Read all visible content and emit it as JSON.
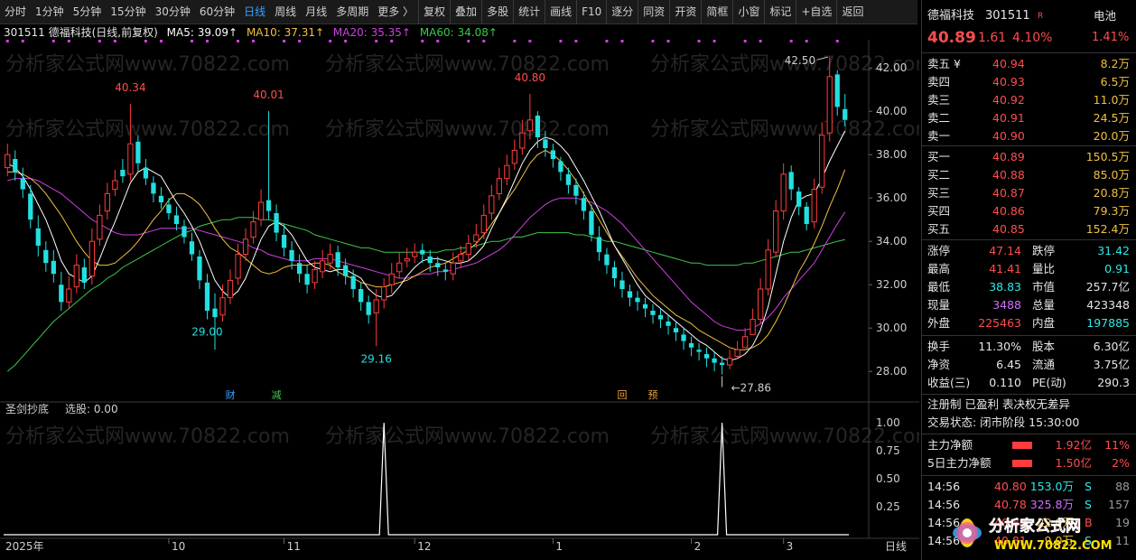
{
  "toolbar": {
    "periods": [
      "分时",
      "1分钟",
      "5分钟",
      "15分钟",
      "30分钟",
      "60分钟",
      "日线",
      "周线",
      "月线",
      "多周期",
      "更多 〉"
    ],
    "active": "日线",
    "tools": [
      "复权",
      "叠加",
      "多股",
      "统计",
      "画线",
      "F10",
      "逐分",
      "同资",
      "开资",
      "简框",
      "小窗",
      "标记",
      "+自选",
      "返回"
    ]
  },
  "header": {
    "stock": "301511 德福科技(日线,前复权)",
    "ma5": "MA5: 39.09↑",
    "ma10": "MA10: 37.31↑",
    "ma20": "MA20: 35.35↑",
    "ma60": "MA60: 34.08↑"
  },
  "sub_header": {
    "name": "圣剑抄底",
    "value": "选股: 0.00"
  },
  "watermark": "分析家公式网www.70822.com",
  "colors": {
    "up": "#ff3c3c",
    "down": "#22e0e0",
    "ma5": "#ffffff",
    "ma10": "#f0c040",
    "ma20": "#d040e0",
    "ma60": "#3cc84a"
  },
  "chart_data": {
    "type": "candlestick",
    "ylim": [
      27.3,
      43.3
    ],
    "y_ticks": [
      "42.00",
      "40.00",
      "38.00",
      "36.00",
      "34.00",
      "32.00",
      "30.00",
      "28.00"
    ],
    "y_tick_values": [
      42,
      40,
      38,
      36,
      34,
      32,
      30,
      28
    ],
    "x_ticks": [
      "2025年",
      "10",
      "11",
      "12",
      "1",
      "2",
      "3"
    ],
    "x_tick_idx": [
      0,
      21,
      36,
      53,
      71,
      89,
      101
    ],
    "annotations_high": [
      {
        "i": 16,
        "label": "40.34"
      },
      {
        "i": 34,
        "label": "40.01"
      },
      {
        "i": 68,
        "label": "40.80"
      },
      {
        "i": 107,
        "label": "42.50"
      }
    ],
    "annotations_low": [
      {
        "i": 26,
        "label": "29.00"
      },
      {
        "i": 48,
        "label": "29.16"
      },
      {
        "i": 93,
        "label": "27.86"
      }
    ],
    "events": [
      {
        "i": 29,
        "label": "财"
      },
      {
        "i": 35,
        "label": "减"
      },
      {
        "i": 80,
        "label": "回"
      },
      {
        "i": 84,
        "label": "预"
      }
    ],
    "closes": [
      38.0,
      37.2,
      36.4,
      35.0,
      33.8,
      33.0,
      32.5,
      31.2,
      31.8,
      32.9,
      32.1,
      34.0,
      35.2,
      36.2,
      36.8,
      37.0,
      38.5,
      37.6,
      36.9,
      36.2,
      35.8,
      35.3,
      34.8,
      34.2,
      33.4,
      32.2,
      30.8,
      30.5,
      31.4,
      32.2,
      33.4,
      34.1,
      34.9,
      35.8,
      35.4,
      34.4,
      33.7,
      33.1,
      32.5,
      32.0,
      32.7,
      33.1,
      33.4,
      32.8,
      32.4,
      31.8,
      31.2,
      30.6,
      31.3,
      31.9,
      32.5,
      33.0,
      33.2,
      33.5,
      33.4,
      33.0,
      32.8,
      32.6,
      33.0,
      33.4,
      33.9,
      34.3,
      35.2,
      36.1,
      36.9,
      37.5,
      38.2,
      39.0,
      39.6,
      38.8,
      38.3,
      37.8,
      37.2,
      36.6,
      36.1,
      35.4,
      34.3,
      33.5,
      32.9,
      32.3,
      31.8,
      31.4,
      31.2,
      30.9,
      30.6,
      30.4,
      30.1,
      29.8,
      29.4,
      29.1,
      28.9,
      28.6,
      28.4,
      28.3,
      28.6,
      29.0,
      29.6,
      30.4,
      31.8,
      33.6,
      35.4,
      37.1,
      36.4,
      35.6,
      34.8,
      36.4,
      38.9,
      41.6,
      40.2,
      39.6
    ],
    "opens": [
      37.4,
      37.8,
      36.9,
      36.2,
      34.6,
      33.6,
      33.1,
      32.0,
      31.2,
      31.9,
      32.8,
      32.4,
      34.1,
      35.4,
      36.4,
      37.3,
      37.1,
      38.6,
      37.4,
      36.7,
      36.1,
      35.7,
      35.2,
      34.7,
      34.0,
      33.3,
      32.1,
      30.9,
      30.6,
      31.4,
      32.3,
      33.4,
      34.2,
      35.0,
      35.9,
      35.3,
      34.3,
      33.6,
      33.0,
      32.5,
      32.1,
      32.6,
      33.0,
      33.5,
      32.9,
      32.4,
      31.8,
      31.2,
      30.7,
      31.3,
      32.0,
      32.6,
      33.1,
      33.3,
      33.6,
      33.3,
      33.0,
      32.7,
      32.5,
      33.1,
      33.4,
      34.0,
      34.4,
      35.3,
      36.2,
      36.9,
      37.6,
      38.3,
      39.1,
      39.8,
      38.7,
      38.2,
      37.7,
      37.1,
      36.6,
      36.0,
      35.4,
      34.2,
      33.4,
      32.8,
      32.2,
      31.7,
      31.4,
      31.1,
      30.8,
      30.6,
      30.3,
      30.0,
      29.7,
      29.3,
      29.0,
      28.8,
      28.6,
      28.4,
      28.3,
      28.7,
      29.1,
      29.7,
      30.4,
      31.8,
      33.5,
      35.4,
      37.2,
      36.3,
      35.6,
      34.9,
      36.5,
      39.0,
      41.7,
      40.1
    ],
    "highs": [
      38.5,
      38.2,
      37.4,
      36.6,
      35.2,
      34.0,
      33.6,
      32.6,
      32.4,
      33.4,
      33.2,
      34.6,
      35.7,
      36.7,
      37.3,
      37.8,
      40.34,
      38.9,
      37.8,
      37.0,
      36.5,
      36.0,
      35.6,
      35.0,
      34.4,
      33.6,
      32.5,
      31.6,
      32.0,
      32.7,
      33.9,
      34.6,
      35.4,
      36.4,
      40.01,
      35.7,
      34.8,
      34.0,
      33.4,
      32.9,
      33.1,
      33.6,
      33.9,
      33.8,
      33.2,
      32.7,
      32.1,
      31.5,
      31.8,
      32.3,
      33.0,
      33.5,
      33.7,
      33.9,
      33.9,
      33.6,
      33.3,
      33.0,
      33.5,
      33.8,
      34.3,
      34.8,
      35.7,
      36.6,
      37.4,
      38.0,
      38.7,
      39.6,
      40.8,
      40.0,
      39.1,
      38.5,
      37.9,
      37.4,
      36.9,
      36.3,
      35.7,
      34.7,
      33.7,
      33.1,
      32.6,
      32.0,
      31.7,
      31.4,
      31.1,
      30.9,
      30.6,
      30.3,
      30.0,
      29.6,
      29.3,
      29.1,
      28.9,
      28.7,
      29.0,
      29.4,
      30.0,
      30.9,
      32.3,
      34.1,
      35.9,
      37.6,
      37.5,
      36.5,
      35.8,
      36.9,
      39.5,
      42.5,
      41.9,
      40.8
    ],
    "lows": [
      37.0,
      36.8,
      36.0,
      34.6,
      33.3,
      32.6,
      32.1,
      30.8,
      30.9,
      31.6,
      31.8,
      32.0,
      33.8,
      35.0,
      36.1,
      36.7,
      36.8,
      37.2,
      36.6,
      35.8,
      35.5,
      35.0,
      34.5,
      33.9,
      33.1,
      31.8,
      30.4,
      29.0,
      30.3,
      31.1,
      32.0,
      33.1,
      33.9,
      34.7,
      35.0,
      34.0,
      33.3,
      32.7,
      32.1,
      31.6,
      31.8,
      32.3,
      32.7,
      32.4,
      32.0,
      31.4,
      30.8,
      30.2,
      29.16,
      30.9,
      31.6,
      32.3,
      32.8,
      33.0,
      33.0,
      32.6,
      32.4,
      32.2,
      32.2,
      32.8,
      33.1,
      33.7,
      34.1,
      35.0,
      35.9,
      36.6,
      37.3,
      38.0,
      38.7,
      38.3,
      37.9,
      37.4,
      36.8,
      36.2,
      35.7,
      35.0,
      34.0,
      33.1,
      32.5,
      31.9,
      31.4,
      31.0,
      30.8,
      30.5,
      30.2,
      30.0,
      29.7,
      29.4,
      29.0,
      28.7,
      28.5,
      28.2,
      28.0,
      27.86,
      28.1,
      28.6,
      29.2,
      30.0,
      30.2,
      31.5,
      33.3,
      35.0,
      35.9,
      35.2,
      34.5,
      34.6,
      36.2,
      38.6,
      39.8,
      39.3
    ],
    "ma5": [
      37.6,
      37.4,
      37.0,
      36.4,
      35.7,
      35.0,
      34.1,
      33.1,
      32.5,
      32.3,
      32.1,
      32.4,
      33.2,
      34.1,
      34.9,
      35.8,
      36.7,
      37.2,
      37.4,
      37.2,
      37.0,
      36.4,
      35.8,
      35.3,
      34.7,
      34.0,
      33.1,
      32.2,
      31.7,
      31.4,
      31.7,
      32.3,
      33.2,
      34.1,
      34.7,
      34.9,
      34.7,
      34.3,
      33.7,
      33.1,
      32.8,
      32.7,
      32.6,
      32.7,
      32.7,
      32.5,
      32.3,
      31.8,
      31.5,
      31.4,
      31.5,
      31.9,
      32.4,
      32.8,
      33.1,
      33.2,
      33.2,
      33.1,
      33.0,
      33.0,
      33.1,
      33.4,
      33.8,
      34.6,
      35.3,
      36.0,
      36.8,
      37.6,
      38.2,
      38.6,
      38.8,
      38.7,
      38.4,
      38.0,
      37.4,
      36.8,
      36.1,
      35.4,
      34.6,
      33.8,
      33.2,
      32.6,
      32.0,
      31.5,
      31.2,
      30.9,
      30.6,
      30.3,
      30.0,
      29.7,
      29.4,
      29.2,
      28.9,
      28.6,
      28.5,
      28.6,
      28.8,
      29.2,
      29.9,
      31.0,
      32.5,
      34.0,
      35.1,
      35.9,
      36.1,
      36.2,
      36.9,
      37.7,
      38.4,
      39.09
    ],
    "ma10": [
      37.2,
      37.2,
      37.1,
      36.9,
      36.6,
      36.2,
      35.7,
      35.2,
      34.6,
      34.0,
      33.5,
      33.1,
      32.9,
      32.9,
      33.0,
      33.3,
      33.6,
      34.0,
      34.5,
      35.0,
      35.4,
      35.9,
      36.2,
      36.2,
      36.0,
      35.7,
      35.2,
      34.6,
      34.1,
      33.7,
      33.5,
      33.2,
      32.9,
      32.6,
      32.5,
      32.6,
      32.8,
      32.9,
      32.9,
      32.9,
      33.0,
      33.0,
      32.9,
      32.6,
      32.4,
      32.3,
      32.1,
      32.0,
      31.9,
      31.9,
      32.0,
      32.1,
      32.2,
      32.4,
      32.6,
      32.8,
      32.9,
      33.0,
      33.2,
      33.4,
      33.6,
      33.9,
      34.3,
      34.8,
      35.3,
      35.9,
      36.4,
      37.0,
      37.6,
      38.0,
      38.2,
      38.0,
      37.7,
      37.3,
      36.8,
      36.2,
      35.6,
      35.0,
      34.4,
      33.8,
      33.3,
      32.8,
      32.3,
      31.9,
      31.5,
      31.2,
      30.9,
      30.6,
      30.4,
      30.2,
      29.9,
      29.7,
      29.5,
      29.3,
      29.1,
      29.0,
      29.0,
      29.1,
      29.3,
      29.7,
      30.3,
      31.0,
      31.8,
      32.6,
      33.2,
      33.9,
      34.7,
      35.6,
      36.4,
      37.31
    ],
    "ma20": [
      36.8,
      36.9,
      36.9,
      36.9,
      36.8,
      36.6,
      36.4,
      36.2,
      35.9,
      35.6,
      35.3,
      35.0,
      34.8,
      34.6,
      34.4,
      34.3,
      34.3,
      34.3,
      34.4,
      34.5,
      34.6,
      34.6,
      34.6,
      34.6,
      34.6,
      34.5,
      34.4,
      34.3,
      34.2,
      34.1,
      34.0,
      33.9,
      33.7,
      33.6,
      33.4,
      33.3,
      33.2,
      33.1,
      33.1,
      33.1,
      33.2,
      33.2,
      33.2,
      33.1,
      33.0,
      32.9,
      32.8,
      32.7,
      32.6,
      32.5,
      32.4,
      32.3,
      32.3,
      32.4,
      32.5,
      32.5,
      32.6,
      32.6,
      32.7,
      32.8,
      32.9,
      33.0,
      33.2,
      33.4,
      33.6,
      33.9,
      34.3,
      34.7,
      35.1,
      35.4,
      35.7,
      35.9,
      36.0,
      36.0,
      36.0,
      35.9,
      35.8,
      35.6,
      35.4,
      35.1,
      34.8,
      34.4,
      34.0,
      33.6,
      33.2,
      32.8,
      32.4,
      32.0,
      31.6,
      31.2,
      30.9,
      30.6,
      30.3,
      30.1,
      30.0,
      29.9,
      29.9,
      30.0,
      30.2,
      30.5,
      30.9,
      31.4,
      31.8,
      32.2,
      32.6,
      33.0,
      33.6,
      34.2,
      34.8,
      35.35
    ],
    "ma60": [
      28.0,
      28.3,
      28.7,
      29.1,
      29.5,
      29.9,
      30.3,
      30.6,
      30.9,
      31.2,
      31.5,
      31.8,
      32.0,
      32.3,
      32.5,
      32.8,
      33.0,
      33.2,
      33.4,
      33.6,
      33.8,
      34.0,
      34.2,
      34.4,
      34.5,
      34.7,
      34.8,
      34.9,
      35.0,
      35.0,
      35.1,
      35.1,
      35.1,
      35.0,
      35.0,
      34.9,
      34.8,
      34.7,
      34.6,
      34.5,
      34.3,
      34.2,
      34.1,
      34.0,
      33.9,
      33.8,
      33.7,
      33.7,
      33.6,
      33.5,
      33.5,
      33.5,
      33.5,
      33.5,
      33.5,
      33.5,
      33.5,
      33.6,
      33.6,
      33.7,
      33.7,
      33.8,
      33.9,
      34.0,
      34.0,
      34.1,
      34.2,
      34.2,
      34.3,
      34.4,
      34.4,
      34.4,
      34.4,
      34.4,
      34.3,
      34.3,
      34.2,
      34.1,
      34.0,
      34.0,
      33.9,
      33.8,
      33.7,
      33.6,
      33.5,
      33.4,
      33.3,
      33.2,
      33.1,
      33.0,
      33.0,
      32.9,
      32.9,
      32.9,
      32.9,
      32.9,
      33.0,
      33.0,
      33.1,
      33.2,
      33.3,
      33.4,
      33.5,
      33.5,
      33.6,
      33.7,
      33.8,
      33.9,
      34.0,
      34.08
    ],
    "sub_ylim": [
      0,
      1.05
    ],
    "sub_ticks": [
      "1.00",
      "0.75",
      "0.50",
      "0.25"
    ],
    "sub_tick_values": [
      1.0,
      0.75,
      0.5,
      0.25
    ],
    "sub_spikes": [
      {
        "i": 49,
        "value": 1.0
      },
      {
        "i": 93,
        "value": 1.0
      }
    ],
    "bottom_right_label": "日线"
  },
  "panel": {
    "name": "德福科技",
    "code": "301511",
    "badge": "R",
    "sector": "电池",
    "sector_pct": "1.41%",
    "price": "40.89",
    "change": "1.61",
    "change_pct": "4.10%",
    "asks": [
      {
        "label": "卖五 ¥",
        "price": "40.94",
        "vol": "8.2万"
      },
      {
        "label": "卖四",
        "price": "40.93",
        "vol": "6.5万"
      },
      {
        "label": "卖三",
        "price": "40.92",
        "vol": "11.0万"
      },
      {
        "label": "卖二",
        "price": "40.91",
        "vol": "24.5万"
      },
      {
        "label": "卖一",
        "price": "40.90",
        "vol": "20.0万"
      }
    ],
    "bids": [
      {
        "label": "买一",
        "price": "40.89",
        "vol": "150.5万"
      },
      {
        "label": "买二",
        "price": "40.88",
        "vol": "85.0万"
      },
      {
        "label": "买三",
        "price": "40.87",
        "vol": "20.8万"
      },
      {
        "label": "买四",
        "price": "40.86",
        "vol": "79.3万"
      },
      {
        "label": "买五",
        "price": "40.85",
        "vol": "152.4万"
      }
    ],
    "stats": [
      {
        "l1": "涨停",
        "v1": "47.14",
        "c1": "red",
        "l2": "跌停",
        "v2": "31.42",
        "c2": "green"
      },
      {
        "l1": "最高",
        "v1": "41.41",
        "c1": "red",
        "l2": "量比",
        "v2": "0.91",
        "c2": "green"
      },
      {
        "l1": "最低",
        "v1": "38.83",
        "c1": "green",
        "l2": "市值",
        "v2": "257.7亿",
        "c2": "white"
      },
      {
        "l1": "现量",
        "v1": "3488",
        "c1": "purple",
        "l2": "总量",
        "v2": "423348",
        "c2": "white"
      },
      {
        "l1": "外盘",
        "v1": "225463",
        "c1": "red",
        "l2": "内盘",
        "v2": "197885",
        "c2": "green"
      }
    ],
    "stats2": [
      {
        "l1": "换手",
        "v1": "11.30%",
        "l2": "股本",
        "v2": "6.30亿"
      },
      {
        "l1": "净资",
        "v1": "6.45",
        "l2": "流通",
        "v2": "3.75亿"
      },
      {
        "l1": "收益(三)",
        "v1": "0.110",
        "l2": "PE(动)",
        "v2": "290.3"
      }
    ],
    "tags": "注册制  已盈利  表决权无差异",
    "status": "交易状态: 闭市阶段 15:30:00",
    "flow": [
      {
        "label": "主力净额",
        "value": "1.92亿",
        "pct": "11%"
      },
      {
        "label": "5日主力净额",
        "value": "1.50亿",
        "pct": "2%"
      }
    ],
    "ticks": [
      {
        "t": "14:56",
        "p": "40.80",
        "v": "153.0万",
        "s": "S",
        "n": "88",
        "pc": "red",
        "vc": "green"
      },
      {
        "t": "14:56",
        "p": "40.78",
        "v": "325.8万",
        "s": "S",
        "n": "157",
        "pc": "red",
        "vc": "purple"
      },
      {
        "t": "14:56",
        "p": "40.80",
        "v": "22.0万",
        "s": "B",
        "n": "19",
        "pc": "red",
        "vc": "yellow"
      },
      {
        "t": "14:56",
        "p": "40.81",
        "v": "9.0万",
        "s": "S",
        "n": "11",
        "pc": "red",
        "vc": "yellow"
      }
    ],
    "logo_text": "分析家公式网",
    "logo_url": "WWW.70822.COM"
  }
}
